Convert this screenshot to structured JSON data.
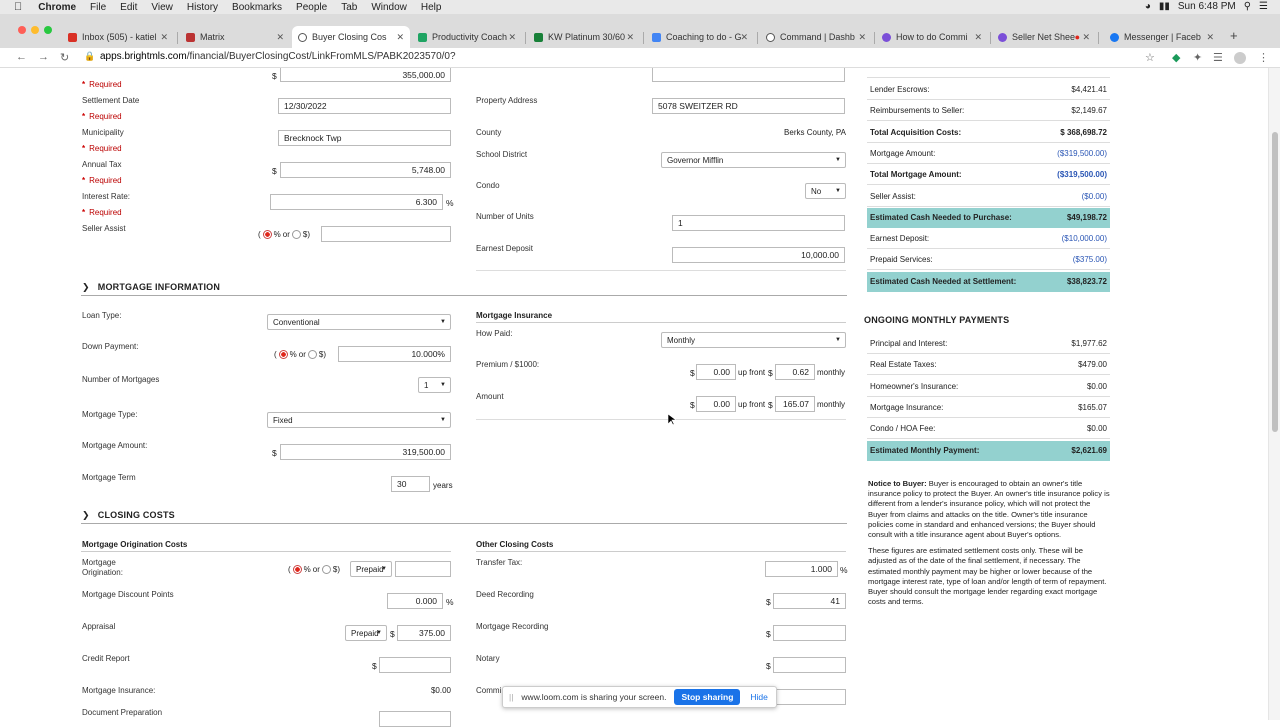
{
  "menubar": {
    "app": "Chrome",
    "items": [
      "File",
      "Edit",
      "View",
      "History",
      "Bookmarks",
      "People",
      "Tab",
      "Window",
      "Help"
    ],
    "clock": "Sun 6:48 PM"
  },
  "tabs": [
    {
      "title": "Inbox (505) - katiel",
      "color": "#d93025"
    },
    {
      "title": "Matrix",
      "color": "#b33"
    },
    {
      "title": "Buyer Closing Cos",
      "color": "#555"
    },
    {
      "title": "Productivity Coach",
      "color": "#1fa463"
    },
    {
      "title": "KW Platinum 30/60",
      "color": "#188038"
    },
    {
      "title": "Coaching to do - G",
      "color": "#4285f4"
    },
    {
      "title": "Command | Dashb",
      "color": "#555"
    },
    {
      "title": "How to do Commi",
      "color": "#7b4fd8"
    },
    {
      "title": "Seller Net Shee",
      "color": "#7b4fd8"
    },
    {
      "title": "Messenger | Faceb",
      "color": "#1877f2"
    }
  ],
  "address": {
    "host": "apps.brightmls.com",
    "path": "/financial/BuyerClosingCost/LinkFromMLS/PABK2023570/0?"
  },
  "form": {
    "required": "Required",
    "price_value": "355,000.00",
    "settlement_date_label": "Settlement Date",
    "settlement_date": "12/30/2022",
    "municipality_label": "Municipality",
    "municipality": "Brecknock Twp",
    "annual_tax_label": "Annual Tax",
    "annual_tax": "5,748.00",
    "interest_rate_label": "Interest Rate:",
    "interest_rate": "6.300",
    "seller_assist_label": "Seller Assist",
    "property_address_label": "Property Address",
    "property_address": "5078 SWEITZER RD",
    "county_label": "County",
    "county": "Berks County, PA",
    "school_district_label": "School District",
    "school_district": "Governor Mifflin",
    "condo_label": "Condo",
    "condo": "No",
    "units_label": "Number of Units",
    "units": "1",
    "earnest_label": "Earnest Deposit",
    "earnest": "10,000.00",
    "pct": "%",
    "or": "or",
    "dollar": "$",
    "dollar_paren": "$)",
    "paren_open": "("
  },
  "mortgage": {
    "section_title": "MORTGAGE INFORMATION",
    "loan_type_label": "Loan Type:",
    "loan_type": "Conventional",
    "down_payment_label": "Down Payment:",
    "down_payment": "10.000%",
    "num_mortgages_label": "Number of Mortgages",
    "num_mortgages": "1",
    "mortgage_type_label": "Mortgage Type:",
    "mortgage_type": "Fixed",
    "mortgage_amount_label": "Mortgage Amount:",
    "mortgage_amount": "319,500.00",
    "term_label": "Mortgage Term",
    "term": "30",
    "years": "years",
    "mi_title": "Mortgage Insurance",
    "how_paid_label": "How Paid:",
    "how_paid": "Monthly",
    "premium_label": "Premium / $1000:",
    "premium_upfront": "0.00",
    "premium_monthly": "0.62",
    "amount_label": "Amount",
    "amount_upfront": "0.00",
    "amount_monthly": "165.07",
    "up_front": "up front",
    "monthly": "monthly"
  },
  "closing": {
    "section_title": "CLOSING COSTS",
    "origination_title": "Mortgage Origination Costs",
    "origination_label": "Mortgage Origination:",
    "prepaid": "Prepaid",
    "discount_label": "Mortgage Discount Points",
    "discount": "0.000",
    "appraisal_label": "Appraisal",
    "appraisal": "375.00",
    "credit_label": "Credit Report",
    "mi_label": "Mortgage Insurance:",
    "mi_value": "$0.00",
    "doc_prep_label": "Document Preparation",
    "other_title": "Other Closing Costs",
    "transfer_label": "Transfer Tax:",
    "transfer": "1.000",
    "deed_label": "Deed Recording",
    "deed": "41",
    "mrec_label": "Mortgage Recording",
    "notary_label": "Notary",
    "commit_label": "Commi"
  },
  "summary": {
    "rows": [
      {
        "label": "Lender Escrows:",
        "value": "$4,421.41",
        "style": ""
      },
      {
        "label": "Reimbursements to Seller:",
        "value": "$2,149.67",
        "style": ""
      },
      {
        "label": "Total Acquisition Costs:",
        "value": "$ 368,698.72",
        "style": "bold"
      },
      {
        "label": "Mortgage Amount:",
        "value": "($319,500.00)",
        "style": "neg"
      },
      {
        "label": "Total Mortgage Amount:",
        "value": "($319,500.00)",
        "style": "bold neg"
      },
      {
        "label": "Seller Assist:",
        "value": "($0.00)",
        "style": "neg"
      },
      {
        "label": "Estimated Cash Needed to Purchase:",
        "value": "$49,198.72",
        "style": "hl"
      },
      {
        "label": "Earnest Deposit:",
        "value": "($10,000.00)",
        "style": "neg"
      },
      {
        "label": "Prepaid Services:",
        "value": "($375.00)",
        "style": "neg"
      },
      {
        "label": "Estimated Cash Needed at Settlement:",
        "value": "$38,823.72",
        "style": "hl"
      }
    ],
    "monthly_title": "ONGOING MONTHLY PAYMENTS",
    "monthly": [
      {
        "label": "Principal and Interest:",
        "value": "$1,977.62",
        "style": ""
      },
      {
        "label": "Real Estate Taxes:",
        "value": "$479.00",
        "style": ""
      },
      {
        "label": "Homeowner's Insurance:",
        "value": "$0.00",
        "style": ""
      },
      {
        "label": "Mortgage Insurance:",
        "value": "$165.07",
        "style": ""
      },
      {
        "label": "Condo / HOA Fee:",
        "value": "$0.00",
        "style": ""
      },
      {
        "label": "Estimated Monthly Payment:",
        "value": "$2,621.69",
        "style": "hl"
      }
    ],
    "notice_lead": "Notice to Buyer:",
    "notice_text": "Buyer is encouraged to obtain an owner's title insurance policy to protect the Buyer. An owner's title insurance policy is different from a lender's insurance policy, which will not protect the Buyer from claims and attacks on the title. Owner's title insurance policies come in standard and enhanced versions; the Buyer should consult with a title insurance agent about Buyer's options.",
    "notice_text2": "These figures are estimated settlement costs only. These will be adjusted as of the date of the final settlement, if necessary. The estimated monthly payment may be higher or lower because of the mortgage interest rate, type of loan and/or length of term of repayment. Buyer should consult the mortgage lender regarding exact mortgage costs and terms."
  },
  "loom": {
    "message": "www.loom.com is sharing your screen.",
    "stop": "Stop sharing",
    "hide": "Hide"
  }
}
